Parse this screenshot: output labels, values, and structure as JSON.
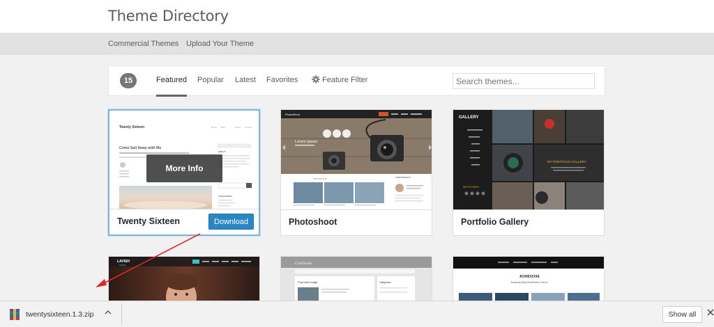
{
  "header": {
    "title": "Theme Directory"
  },
  "subnav": {
    "items": [
      "Commercial Themes",
      "Upload Your Theme"
    ]
  },
  "filters": {
    "count": "15",
    "tabs": [
      "Featured",
      "Popular",
      "Latest",
      "Favorites"
    ],
    "active_tab": "Featured",
    "feature_filter": "Feature Filter",
    "search_placeholder": "Search themes..."
  },
  "themes": [
    {
      "name": "Twenty Sixteen",
      "hover_label": "More Info",
      "download_label": "Download",
      "preview": {
        "site_title": "Twenty Sixteen",
        "post_title": "Come Sail Away with Me",
        "menu": [
          "Home",
          "Blog",
          "About",
          "Contact"
        ],
        "sidebar_headings": [
          "ABOUT",
          "CATEGORIES"
        ]
      }
    },
    {
      "name": "Photoshoot",
      "preview": {
        "site_title": "PhotoShoot",
        "hero_title": "Lorem Ipsum",
        "top_label": "TOP PHOTOS",
        "testimonials": "TESTIMONIALS"
      }
    },
    {
      "name": "Portfolio Gallery",
      "preview": {
        "logo": "GALLERY",
        "tagline": "MY PORTFOLIO GALLERY",
        "contact": "GET IN TOUCH"
      }
    },
    {
      "name": "",
      "preview": {
        "logo": "LAVISH",
        "logo_sub": "THEME"
      }
    },
    {
      "name": "",
      "preview": {
        "logo": "Certitude",
        "post_title": "Post with image",
        "sidebar": "Categories"
      }
    },
    {
      "name": "",
      "preview": {
        "logo": "JOMSOM",
        "tagline": "Amazing Blog WordPress Theme"
      }
    }
  ],
  "download_shelf": {
    "file": "twentysixteen.1.3.zip",
    "show_all": "Show all"
  },
  "colors": {
    "primary_button": "#2b86c4",
    "annotation_arrow": "#e0262b"
  }
}
